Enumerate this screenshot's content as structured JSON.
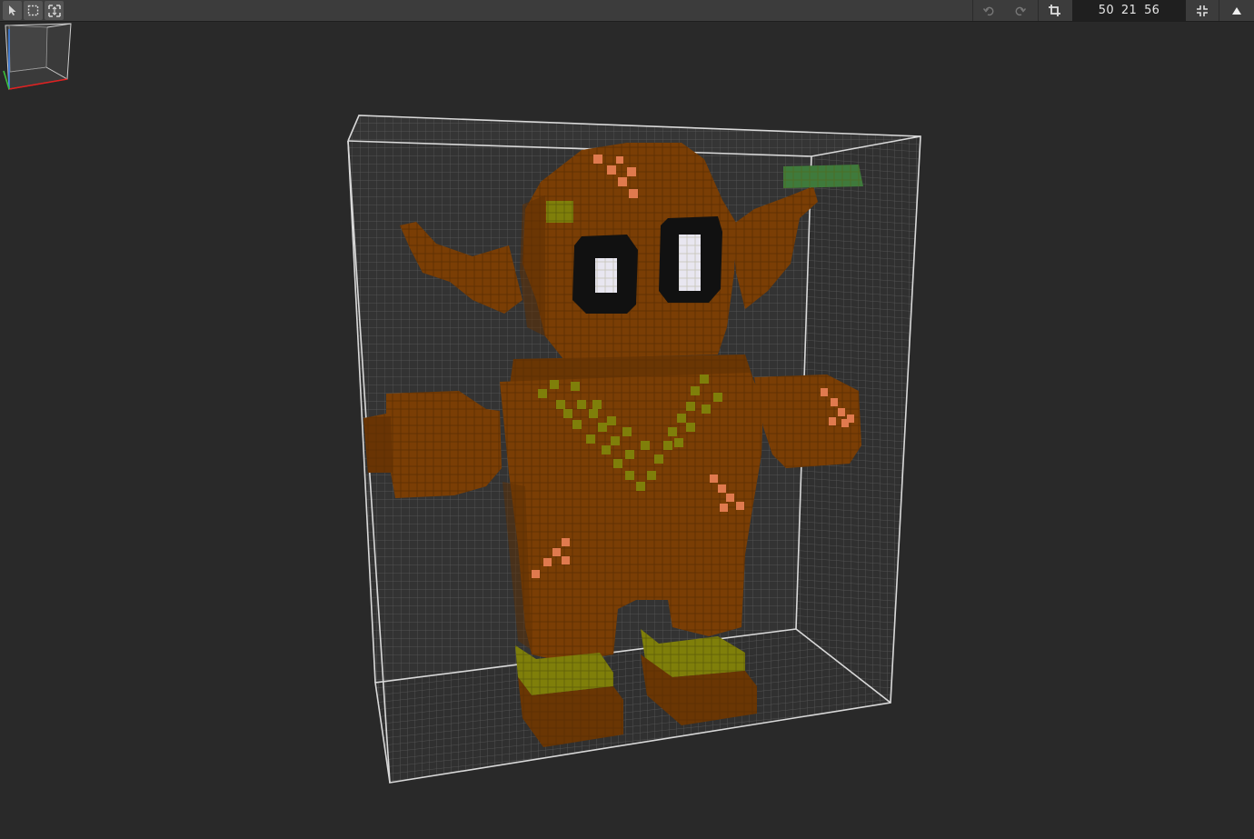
{
  "toolbar": {
    "tools": [
      {
        "name": "select-arrow-tool",
        "icon": "cursor-arrow-icon"
      },
      {
        "name": "box-select-tool",
        "icon": "dashed-square-icon"
      },
      {
        "name": "resize-tool",
        "icon": "expand-frame-icon"
      }
    ],
    "undo_icon": "undo-icon",
    "redo_icon": "redo-icon",
    "crop_icon": "crop-icon",
    "dimensions": {
      "x": "50",
      "y": "21",
      "z": "56"
    },
    "collapse_icon": "compress-icon",
    "menu_icon": "triangle-up-icon"
  },
  "scene": {
    "model": "voxel-character",
    "colors": {
      "background": "#292929",
      "grid_line": "#5a5a5a",
      "grid_panel": "#333333",
      "box_edge": "#d8d8d8",
      "body": "#7a3e05",
      "body_dark": "#5e2f03",
      "body_shade": "#6a3604",
      "olive": "#7f7f0a",
      "olive_light": "#9a9a12",
      "patch": "#e07a4e",
      "eye_black": "#111111",
      "eye_white": "#e8e6f0",
      "leaf": "#3f7a3c"
    }
  },
  "gizmo": {
    "icon": "orientation-cube-icon"
  }
}
